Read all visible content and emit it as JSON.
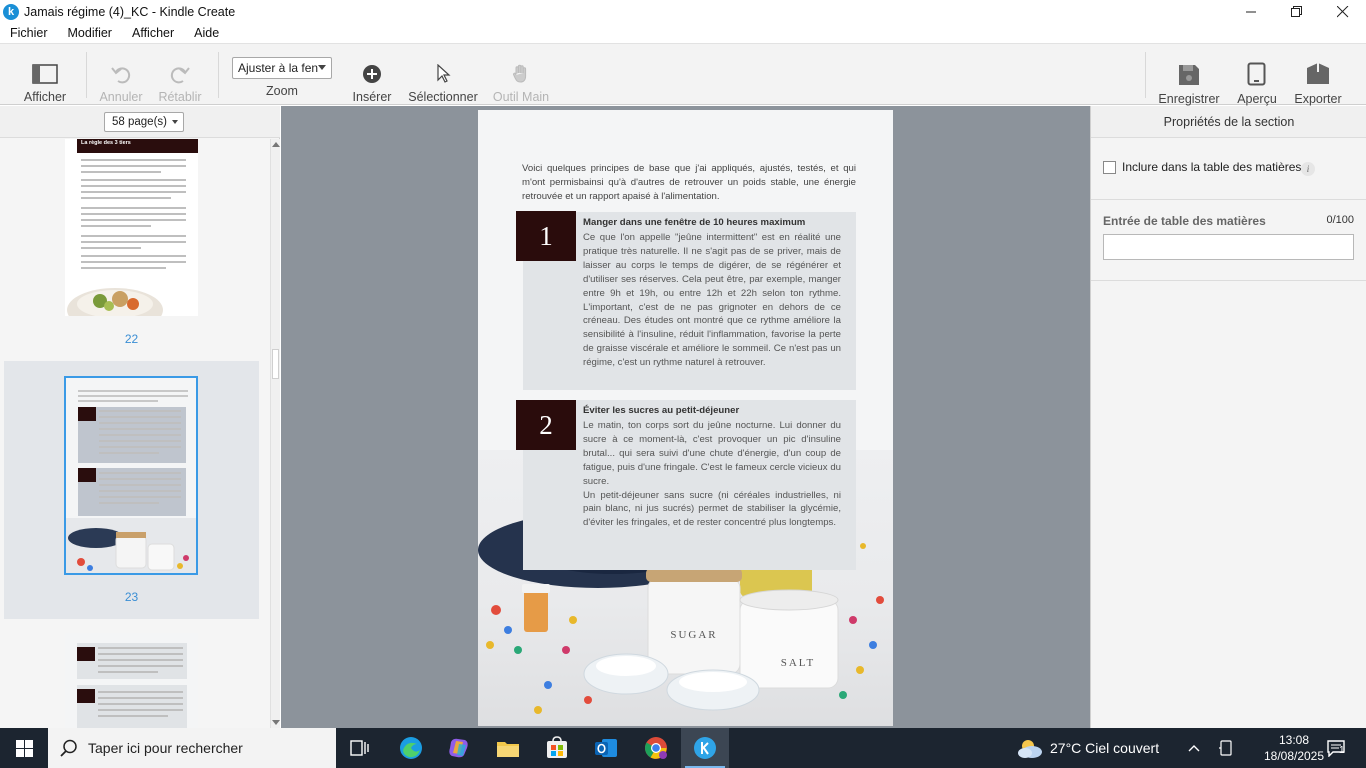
{
  "window": {
    "title": "Jamais régime (4)_KC - Kindle Create",
    "logo_letter": "k"
  },
  "menu": [
    "Fichier",
    "Modifier",
    "Afficher",
    "Aide"
  ],
  "toolbar": {
    "afficher": "Afficher",
    "annuler": "Annuler",
    "retablir": "Rétablir",
    "zoom_value": "Ajuster à la fen",
    "zoom_label": "Zoom",
    "inserer": "Insérer",
    "selectionner": "Sélectionner",
    "outil_main": "Outil Main",
    "enregistrer": "Enregistrer",
    "apercu": "Aperçu",
    "exporter": "Exporter"
  },
  "left_panel": {
    "page_count": "58 page(s)",
    "thumb_title": "La règle des 3 tiers",
    "pages": [
      "22",
      "23"
    ],
    "selected_page": "23"
  },
  "document": {
    "intro": "Voici quelques principes de base que j'ai appliqués, ajustés, testés, et qui m'ont permisbainsi qu'à d'autres de retrouver un poids stable, une énergie retrouvée et un rapport apaisé à l'alimentation.",
    "cards": [
      {
        "num": "1",
        "title": "Manger dans une fenêtre de 10 heures maximum",
        "body": "Ce que l'on appelle \"jeûne intermittent\" est en réalité une pratique très naturelle. Il ne s'agit pas de se priver, mais de laisser au corps le temps de digérer, de se régénérer et d'utiliser ses réserves. Cela peut être, par exemple, manger entre 9h et 19h, ou entre 12h et 22h selon ton rythme. L'important, c'est de ne pas grignoter en dehors de ce créneau. Des études ont montré que ce rythme améliore la sensibilité à l'insuline, réduit l'inflammation, favorise la perte de graisse viscérale et améliore le sommeil. Ce n'est pas un régime, c'est un rythme naturel à retrouver."
      },
      {
        "num": "2",
        "title": "Éviter les sucres au petit-déjeuner",
        "body": "Le matin, ton corps sort du jeûne nocturne. Lui donner du sucre à ce moment-là, c'est provoquer un pic d'insuline brutal... qui sera suivi d'une chute d'énergie, d'un coup de fatigue, puis d'une fringale. C'est le fameux cercle vicieux du sucre.",
        "body2": "Un petit-déjeuner sans sucre (ni céréales industrielles, ni pain blanc, ni jus sucrés) permet de stabiliser la glycémie, d'éviter les fringales, et de rester concentré plus longtemps."
      }
    ],
    "photo_labels": {
      "jar1": "SUGAR",
      "jar2": "SALT"
    }
  },
  "right_panel": {
    "header": "Propriétés de la section",
    "include_toc_label": "Inclure dans la table des matières",
    "info": "i",
    "toc_entry_label": "Entrée de table des matières",
    "toc_count": "0/100",
    "toc_value": ""
  },
  "taskbar": {
    "search_placeholder": "Taper ici pour rechercher",
    "weather": "27°C  Ciel couvert",
    "time": "13:08",
    "date": "18/08/2025",
    "notification_count": "1"
  },
  "colors": {
    "accent": "#1a8fd6",
    "card_dark": "#2a0c0c",
    "canvas_bg": "#8c939b",
    "taskbar": "#1c2530"
  }
}
